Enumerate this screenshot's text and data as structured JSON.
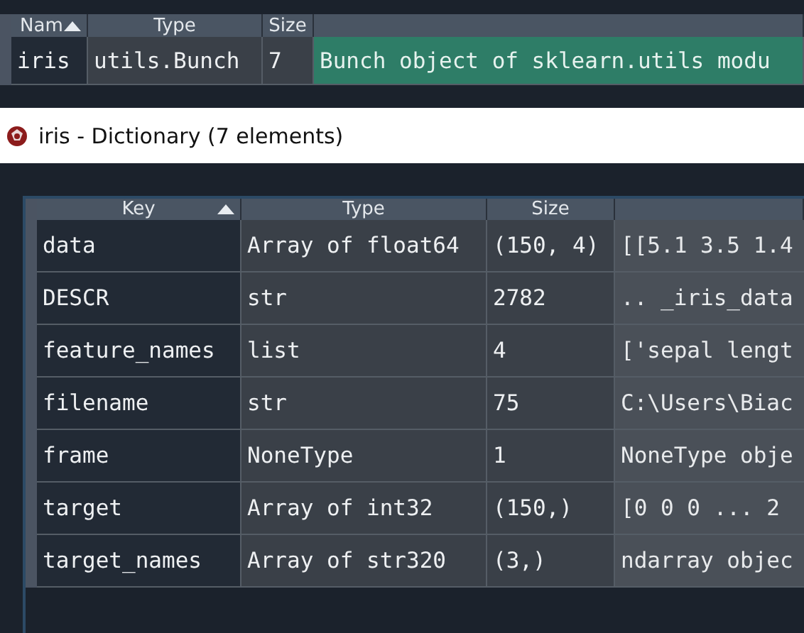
{
  "variable_explorer": {
    "columns": [
      "Nam",
      "Type",
      "Size"
    ],
    "sort_ascending": true,
    "rows": [
      {
        "name": "iris",
        "type": "utils.Bunch",
        "size": "7",
        "value": "Bunch object of sklearn.utils modu"
      }
    ]
  },
  "dictionary_window": {
    "title": "iris - Dictionary (7 elements)",
    "columns": [
      "Key",
      "Type",
      "Size"
    ],
    "sort_ascending": true,
    "rows": [
      {
        "key": "data",
        "type": "Array of float64",
        "size": "(150, 4)",
        "value": "[[5.1 3.5 1.4"
      },
      {
        "key": "DESCR",
        "type": "str",
        "size": "2782",
        "value": ".. _iris_data"
      },
      {
        "key": "feature_names",
        "type": "list",
        "size": "4",
        "value": "['sepal lengt"
      },
      {
        "key": "filename",
        "type": "str",
        "size": "75",
        "value": "C:\\Users\\Biac"
      },
      {
        "key": "frame",
        "type": "NoneType",
        "size": "1",
        "value": "NoneType obje"
      },
      {
        "key": "target",
        "type": "Array of int32",
        "size": "(150,)",
        "value": "[0 0 0 ... 2"
      },
      {
        "key": "target_names",
        "type": "Array of str320",
        "size": "(3,)",
        "value": "ndarray objec"
      }
    ]
  }
}
